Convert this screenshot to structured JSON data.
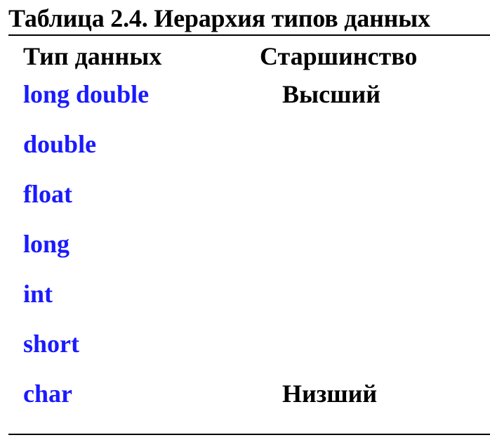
{
  "title": "Таблица 2.4. Иерархия типов данных",
  "headers": {
    "type": "Тип данных",
    "rank": "Старшинство"
  },
  "rows": [
    {
      "type": "long double",
      "rank": "Высший"
    },
    {
      "type": "double",
      "rank": ""
    },
    {
      "type": "float",
      "rank": ""
    },
    {
      "type": "long",
      "rank": ""
    },
    {
      "type": "int",
      "rank": ""
    },
    {
      "type": "short",
      "rank": ""
    },
    {
      "type": "char",
      "rank": "Низший"
    }
  ],
  "colors": {
    "type_text": "#1a1aff",
    "text": "#000000",
    "rule": "#000000"
  }
}
